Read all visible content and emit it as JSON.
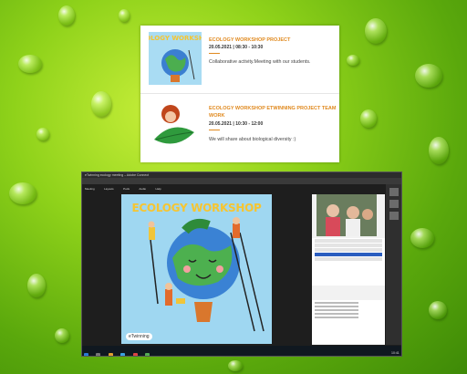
{
  "events": [
    {
      "title": "Ecology workshop project",
      "date": "20.05.2021",
      "time": "08:30 - 10:30",
      "description": "Collaborative activity.Meeting with our students."
    },
    {
      "title": "ECOLOGY WORKSHOP ETWINNING PROJECT TEAM WORK",
      "date": "20.05.2021",
      "time": "10:30 - 12:00",
      "description": "We will share about biological diversity :)"
    }
  ],
  "screen": {
    "window_title": "eTwinning ecology meeting – Adobe Connect",
    "menu": [
      "Meeting",
      "Layouts",
      "Pods",
      "Audio",
      "Help"
    ],
    "slide_title": "ECOLOGY WORKSHOP",
    "slide_badge": "eTwinning",
    "clock": "10:41"
  },
  "colors": {
    "accent": "#e0891e",
    "slide_bg": "#9fd7f1",
    "title_yellow": "#f6c531"
  }
}
